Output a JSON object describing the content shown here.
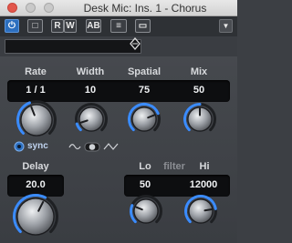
{
  "window": {
    "title": "Desk Mic: Ins. 1 - Chorus"
  },
  "toolbar": {
    "power_label": "⏻",
    "btn2_label": "□",
    "read_label": "R",
    "write_label": "W",
    "btn5_label": "AB",
    "btn6_label": "≡",
    "btn7_label": "▭",
    "menu_label": "▼"
  },
  "preset": {
    "value": ""
  },
  "params": {
    "rate": {
      "label": "Rate",
      "value": "1 / 1",
      "level": 0.42
    },
    "width": {
      "label": "Width",
      "value": "10",
      "level": 0.1
    },
    "spatial": {
      "label": "Spatial",
      "value": "75",
      "level": 0.75
    },
    "mix": {
      "label": "Mix",
      "value": "50",
      "level": 0.5
    },
    "delay": {
      "label": "Delay",
      "value": "20.0",
      "level": 0.6
    },
    "lo": {
      "label": "Lo",
      "value": "50",
      "level": 0.25
    },
    "hi": {
      "label": "Hi",
      "value": "12000",
      "level": 0.8
    }
  },
  "sync_label": "sync",
  "filter_label": "filter",
  "colors": {
    "accent": "#2c6fbf",
    "arc": "#3b8cff",
    "panel": "#3d4045"
  }
}
